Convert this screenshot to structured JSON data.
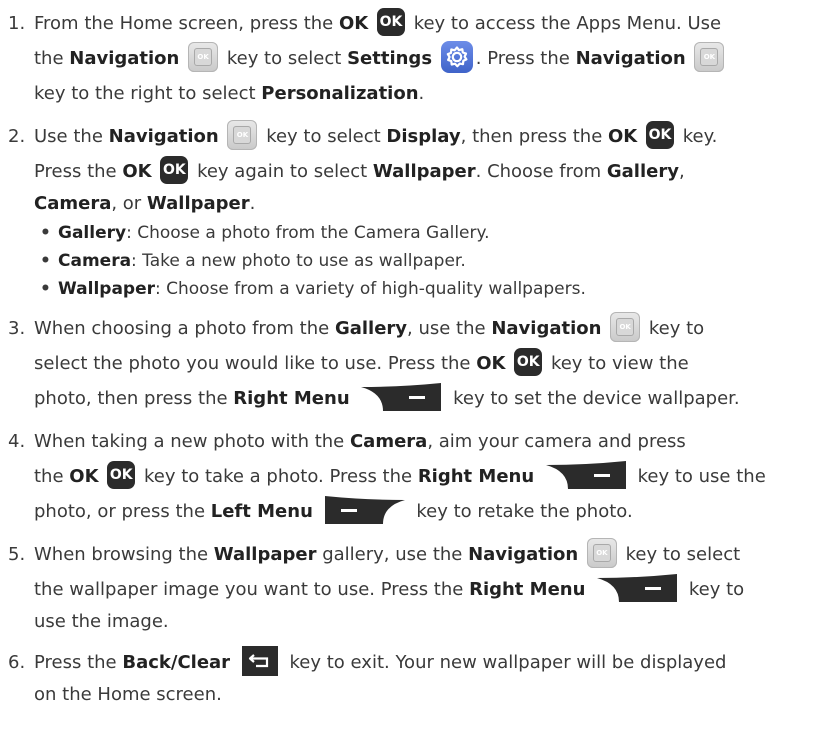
{
  "icons": {
    "ok": "ok-key-icon",
    "navigation": "navigation-key-icon",
    "settings": "settings-gear-icon",
    "right_menu": "right-menu-key-icon",
    "left_menu": "left-menu-key-icon",
    "back": "back-clear-key-icon"
  },
  "colors": {
    "ok_key": "#2b2b2b",
    "settings_key": "#4f73d6",
    "text": "#3a3a3a"
  },
  "ok_glyph": "OK",
  "nav_glyph": "OK",
  "steps": [
    {
      "num": "1.",
      "t1": "From the Home screen, press the ",
      "b1": "OK",
      "t2": " key to access the Apps Menu. Use",
      "t3": "the ",
      "b2": "Navigation",
      "t4": " key to select ",
      "b3": "Settings",
      "t5": ". Press the ",
      "b4": "Navigation",
      "t6": "key to the right to select ",
      "b5": "Personalization",
      "t7": "."
    },
    {
      "num": "2.",
      "t1": "Use the ",
      "b1": "Navigation",
      "t2": " key to select ",
      "b2": "Display",
      "t3": ", then press the ",
      "b3": "OK",
      "t4": " key.",
      "t5": "Press the ",
      "b4": "OK",
      "t6": " key again to select ",
      "b5": "Wallpaper",
      "t7": ". Choose from ",
      "b6": "Gallery",
      "t8": ",",
      "b7": "Camera",
      "t9": ", or ",
      "b8": "Wallpaper",
      "t10": ".",
      "bullet": "•",
      "subs": [
        {
          "b": "Gallery",
          "t": ": Choose a photo from the Camera Gallery."
        },
        {
          "b": "Camera",
          "t": ": Take a new photo to use as wallpaper."
        },
        {
          "b": "Wallpaper",
          "t": ": Choose from a variety of high-quality wallpapers."
        }
      ]
    },
    {
      "num": "3.",
      "t1": "When choosing a photo from the ",
      "b1": "Gallery",
      "t2": ", use the ",
      "b2": "Navigation",
      "t3": " key to",
      "t4": "select the photo you would like to use. Press the ",
      "b3": "OK",
      "t5": " key to view the",
      "t6": "photo, then press the ",
      "b4": "Right Menu",
      "t7": " key to set the device wallpaper."
    },
    {
      "num": "4.",
      "t1": "When taking a new photo with the ",
      "b1": "Camera",
      "t2": ", aim your camera and press",
      "t3": "the ",
      "b2": "OK",
      "t4": " key to take a photo. Press the ",
      "b3": "Right Menu",
      "t5": " key to use the",
      "t6": "photo, or press the ",
      "b4": "Left Menu",
      "t7": " key to retake the photo."
    },
    {
      "num": "5.",
      "t1": "When browsing the ",
      "b1": "Wallpaper",
      "t2": " gallery, use the ",
      "b2": "Navigation",
      "t3": " key to select",
      "t4": "the wallpaper image you want to use. Press the ",
      "b3": "Right Menu",
      "t5": " key to",
      "t6": "use the image."
    },
    {
      "num": "6.",
      "t1": "Press the ",
      "b1": "Back/Clear",
      "t2": " key to exit. Your new wallpaper will be displayed",
      "t3": "on the Home screen."
    }
  ]
}
